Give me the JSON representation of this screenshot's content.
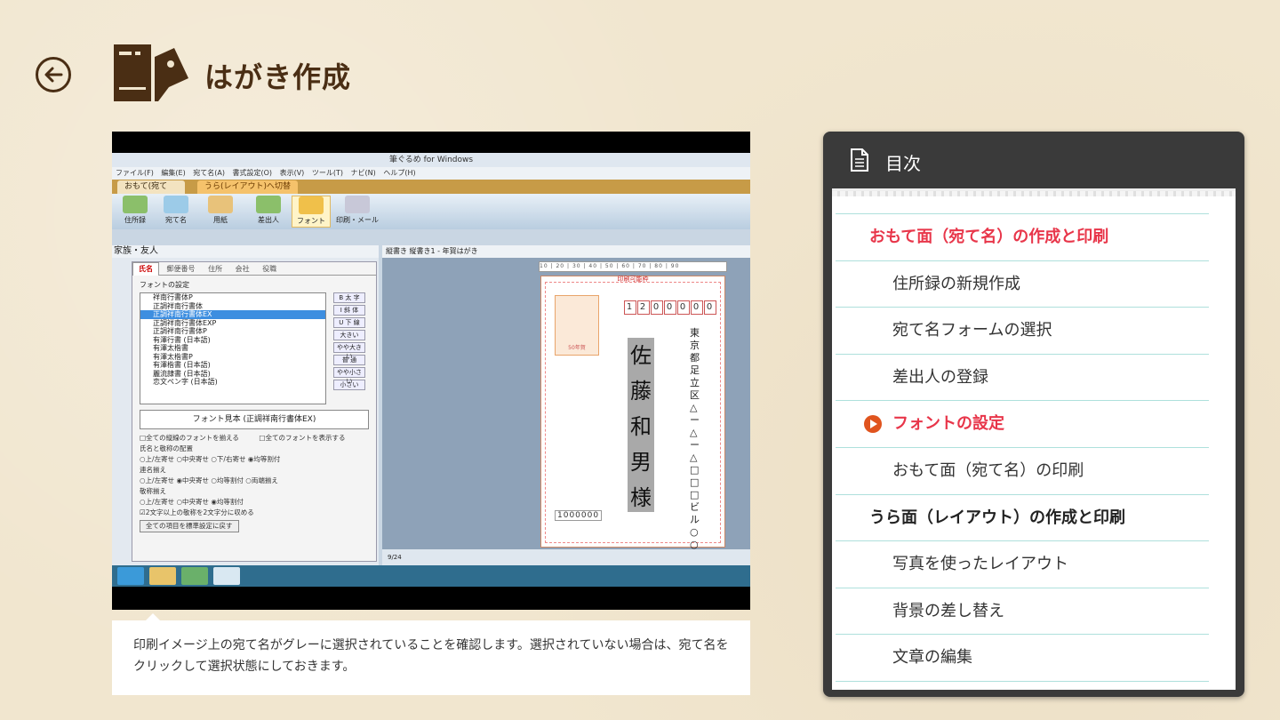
{
  "header": {
    "title": "はがき作成",
    "back_icon": "arrow-left-icon",
    "title_icon": "postcard-icon",
    "accent_color": "#4a2e14"
  },
  "video": {
    "app_title": "筆ぐるめ for Windows",
    "menu": [
      "ファイル(F)",
      "編集(E)",
      "宛て名(A)",
      "書式設定(O)",
      "表示(V)",
      "ツール(T)",
      "ナビ(N)",
      "ヘルプ(H)"
    ],
    "tabs": [
      "おもて(宛て名)",
      "うら(レイアウト)へ切替"
    ],
    "toolbar": [
      "住所録",
      "宛て名",
      "用紙",
      "差出人",
      "フォント",
      "印刷・メール"
    ],
    "left_header": "家族・友人",
    "panel_tabs": [
      "氏名",
      "郵便番号",
      "住所",
      "会社",
      "役職"
    ],
    "font_settings_label": "フォントの設定",
    "fonts": [
      "祥南行書体P",
      "正調祥南行書体",
      "正調祥南行書体EX",
      "正調祥南行書体EXP",
      "正調祥南行書体P",
      "有澤行書 (日本語)",
      "有澤太楷書",
      "有澤太楷書P",
      "有澤楷書 (日本語)",
      "麗流隷書 (日本語)",
      "恋文ペン字 (日本語)"
    ],
    "font_buttons": [
      "B 太 字",
      "I 斜 体",
      "U 下 線",
      "大きい",
      "やや大きい",
      "普 通",
      "やや小さい",
      "小さい"
    ],
    "font_sample": "フォント見本 (正調祥南行書体EX)",
    "options": [
      "□全ての縦線のフォントを揃える　　　□全てのフォントを表示する",
      "氏名と敬称の配置",
      "○上/左寄せ ○中央寄せ ○下/右寄せ ◉均等割付",
      "連名揃え",
      "○上/左寄せ ◉中央寄せ ○均等割付 ○両端揃え",
      "敬称揃え",
      "○上/左寄せ ○中央寄せ ◉均等割付",
      "☑2文字以上の敬称を2文字分に収める"
    ],
    "reset_button": "全ての項目を標準設定に戻す",
    "right_header": "縦書き 縦書き1 - 年賀はがき",
    "ruler": "10 | 20 | 30 | 40 | 50 | 60 | 70 | 80 | 90",
    "postcard_label": "印刷可能枠",
    "zip_digits": [
      "1",
      "2",
      "0",
      "0",
      "0",
      "0",
      "0"
    ],
    "stamp_label": "50年賀",
    "address": "東京都足立区△ー△ー△□□□ビル○○",
    "recipient": "佐藤和男様",
    "sender_zip": "1000000",
    "page_counter": "9/24"
  },
  "caption": "印刷イメージ上の宛て名がグレーに選択されていることを確認します。選択されていない場合は、宛て名をクリックして選択状態にしておきます。",
  "toc": {
    "title": "目次",
    "icon": "document-icon",
    "items": [
      {
        "label": "おもて面（宛て名）の作成と印刷"
      },
      {
        "label": "住所録の新規作成"
      },
      {
        "label": "宛て名フォームの選択"
      },
      {
        "label": "差出人の登録"
      },
      {
        "label": "フォントの設定"
      },
      {
        "label": "おもて面（宛て名）の印刷"
      },
      {
        "label": "うら面（レイアウト）の作成と印刷"
      },
      {
        "label": "写真を使ったレイアウト"
      },
      {
        "label": "背景の差し替え"
      },
      {
        "label": "文章の編集"
      }
    ],
    "highlight_color": "#e8364a"
  }
}
